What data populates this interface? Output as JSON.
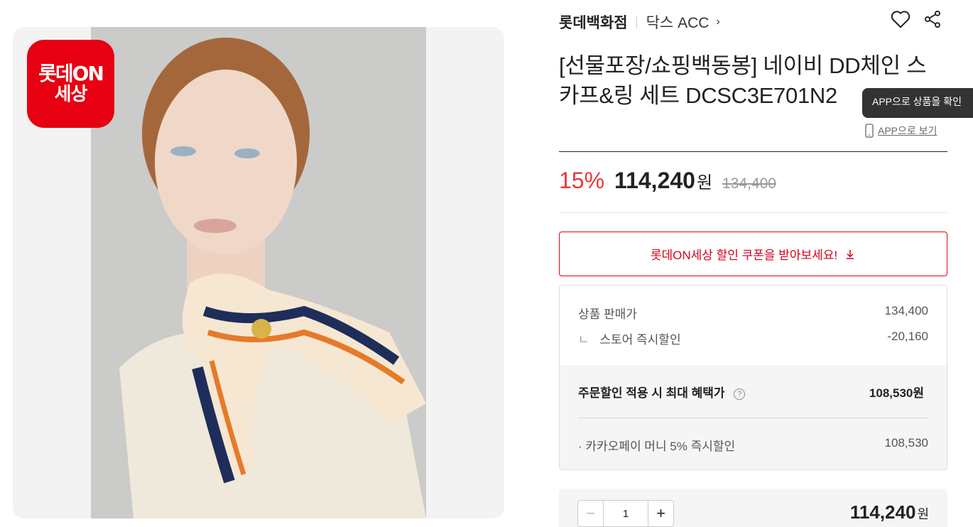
{
  "badge": {
    "line1": "롯데ON",
    "line2": "세상"
  },
  "brand": {
    "name": "롯데백화점",
    "sub": "닥스 ACC",
    "chevron": "›"
  },
  "icons": {
    "wishlist": "heart-icon",
    "share": "share-icon"
  },
  "product": {
    "title": "[선물포장/쇼핑백동봉] 네이비 DD체인 스카프&링 세트 DCSC3E701N2"
  },
  "tooltip": {
    "text": "APP으로 상품을 확인"
  },
  "app_link": {
    "label": "APP으로 보기"
  },
  "price": {
    "rate": "15%",
    "sale": "114,240",
    "won": "원",
    "original": "134,400"
  },
  "coupon": {
    "label": "롯데ON세상 할인 쿠폰을 받아보세요!"
  },
  "breakdown": {
    "list_price_label": "상품 판매가",
    "list_price": "134,400",
    "instant_prefix": "ㄴ",
    "instant_label": "스토어 즉시할인",
    "instant_value": "-20,160",
    "max_benefit_label": "주문할인 적용 시 최대 혜택가",
    "max_benefit_value": "108,530원",
    "kakao_label": "· 카카오페이 머니 5% 즉시할인",
    "kakao_value": "108,530"
  },
  "order": {
    "minus": "−",
    "qty": "1",
    "plus": "+",
    "total": "114,240",
    "won": "원"
  },
  "colors": {
    "accent": "#e60012",
    "discount": "#e8373a"
  }
}
